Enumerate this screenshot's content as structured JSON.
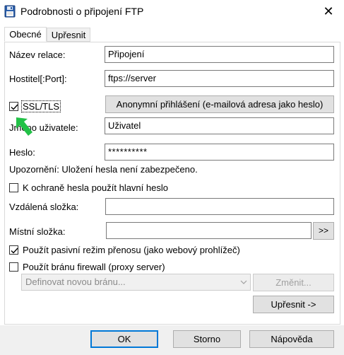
{
  "window": {
    "title": "Podrobnosti o připojení FTP",
    "close_glyph": "✕"
  },
  "tabs": [
    {
      "label": "Obecné",
      "active": true
    },
    {
      "label": "Upřesnit",
      "active": false
    }
  ],
  "form": {
    "session_name": {
      "label": "Název relace:",
      "value": "Připojení"
    },
    "host": {
      "label": "Hostitel[:Port]:",
      "value": "ftps://server"
    },
    "ssl": {
      "label": "SSL/TLS",
      "checked": true
    },
    "anonymous_button": "Anonymní přihlášení (e-mailová adresa jako heslo)",
    "username": {
      "label": "Jméno uživatele:",
      "value": "Uživatel"
    },
    "password": {
      "label": "Heslo:",
      "value": "**********"
    },
    "warning": "Upozornění: Uložení hesla není zabezpečeno.",
    "master_password": {
      "label": "K ochraně hesla použít hlavní heslo",
      "checked": false
    },
    "remote_folder": {
      "label": "Vzdálená složka:",
      "value": ""
    },
    "local_folder": {
      "label": "Místní složka:",
      "value": "",
      "browse_label": ">>"
    },
    "passive_mode": {
      "label": "Použít pasivní režim přenosu (jako webový prohlížeč)",
      "checked": true
    },
    "firewall": {
      "label": "Použít bránu firewall (proxy server)",
      "checked": false
    },
    "firewall_select": {
      "value": "Definovat novou bránu...",
      "disabled": true
    },
    "change_button": "Změnit...",
    "advanced_button": "Upřesnit ->"
  },
  "footer": {
    "ok": "OK",
    "cancel": "Storno",
    "help": "Nápověda"
  },
  "annotation": {
    "arrow_color": "#22c147",
    "icon": "green-arrow-icon"
  }
}
